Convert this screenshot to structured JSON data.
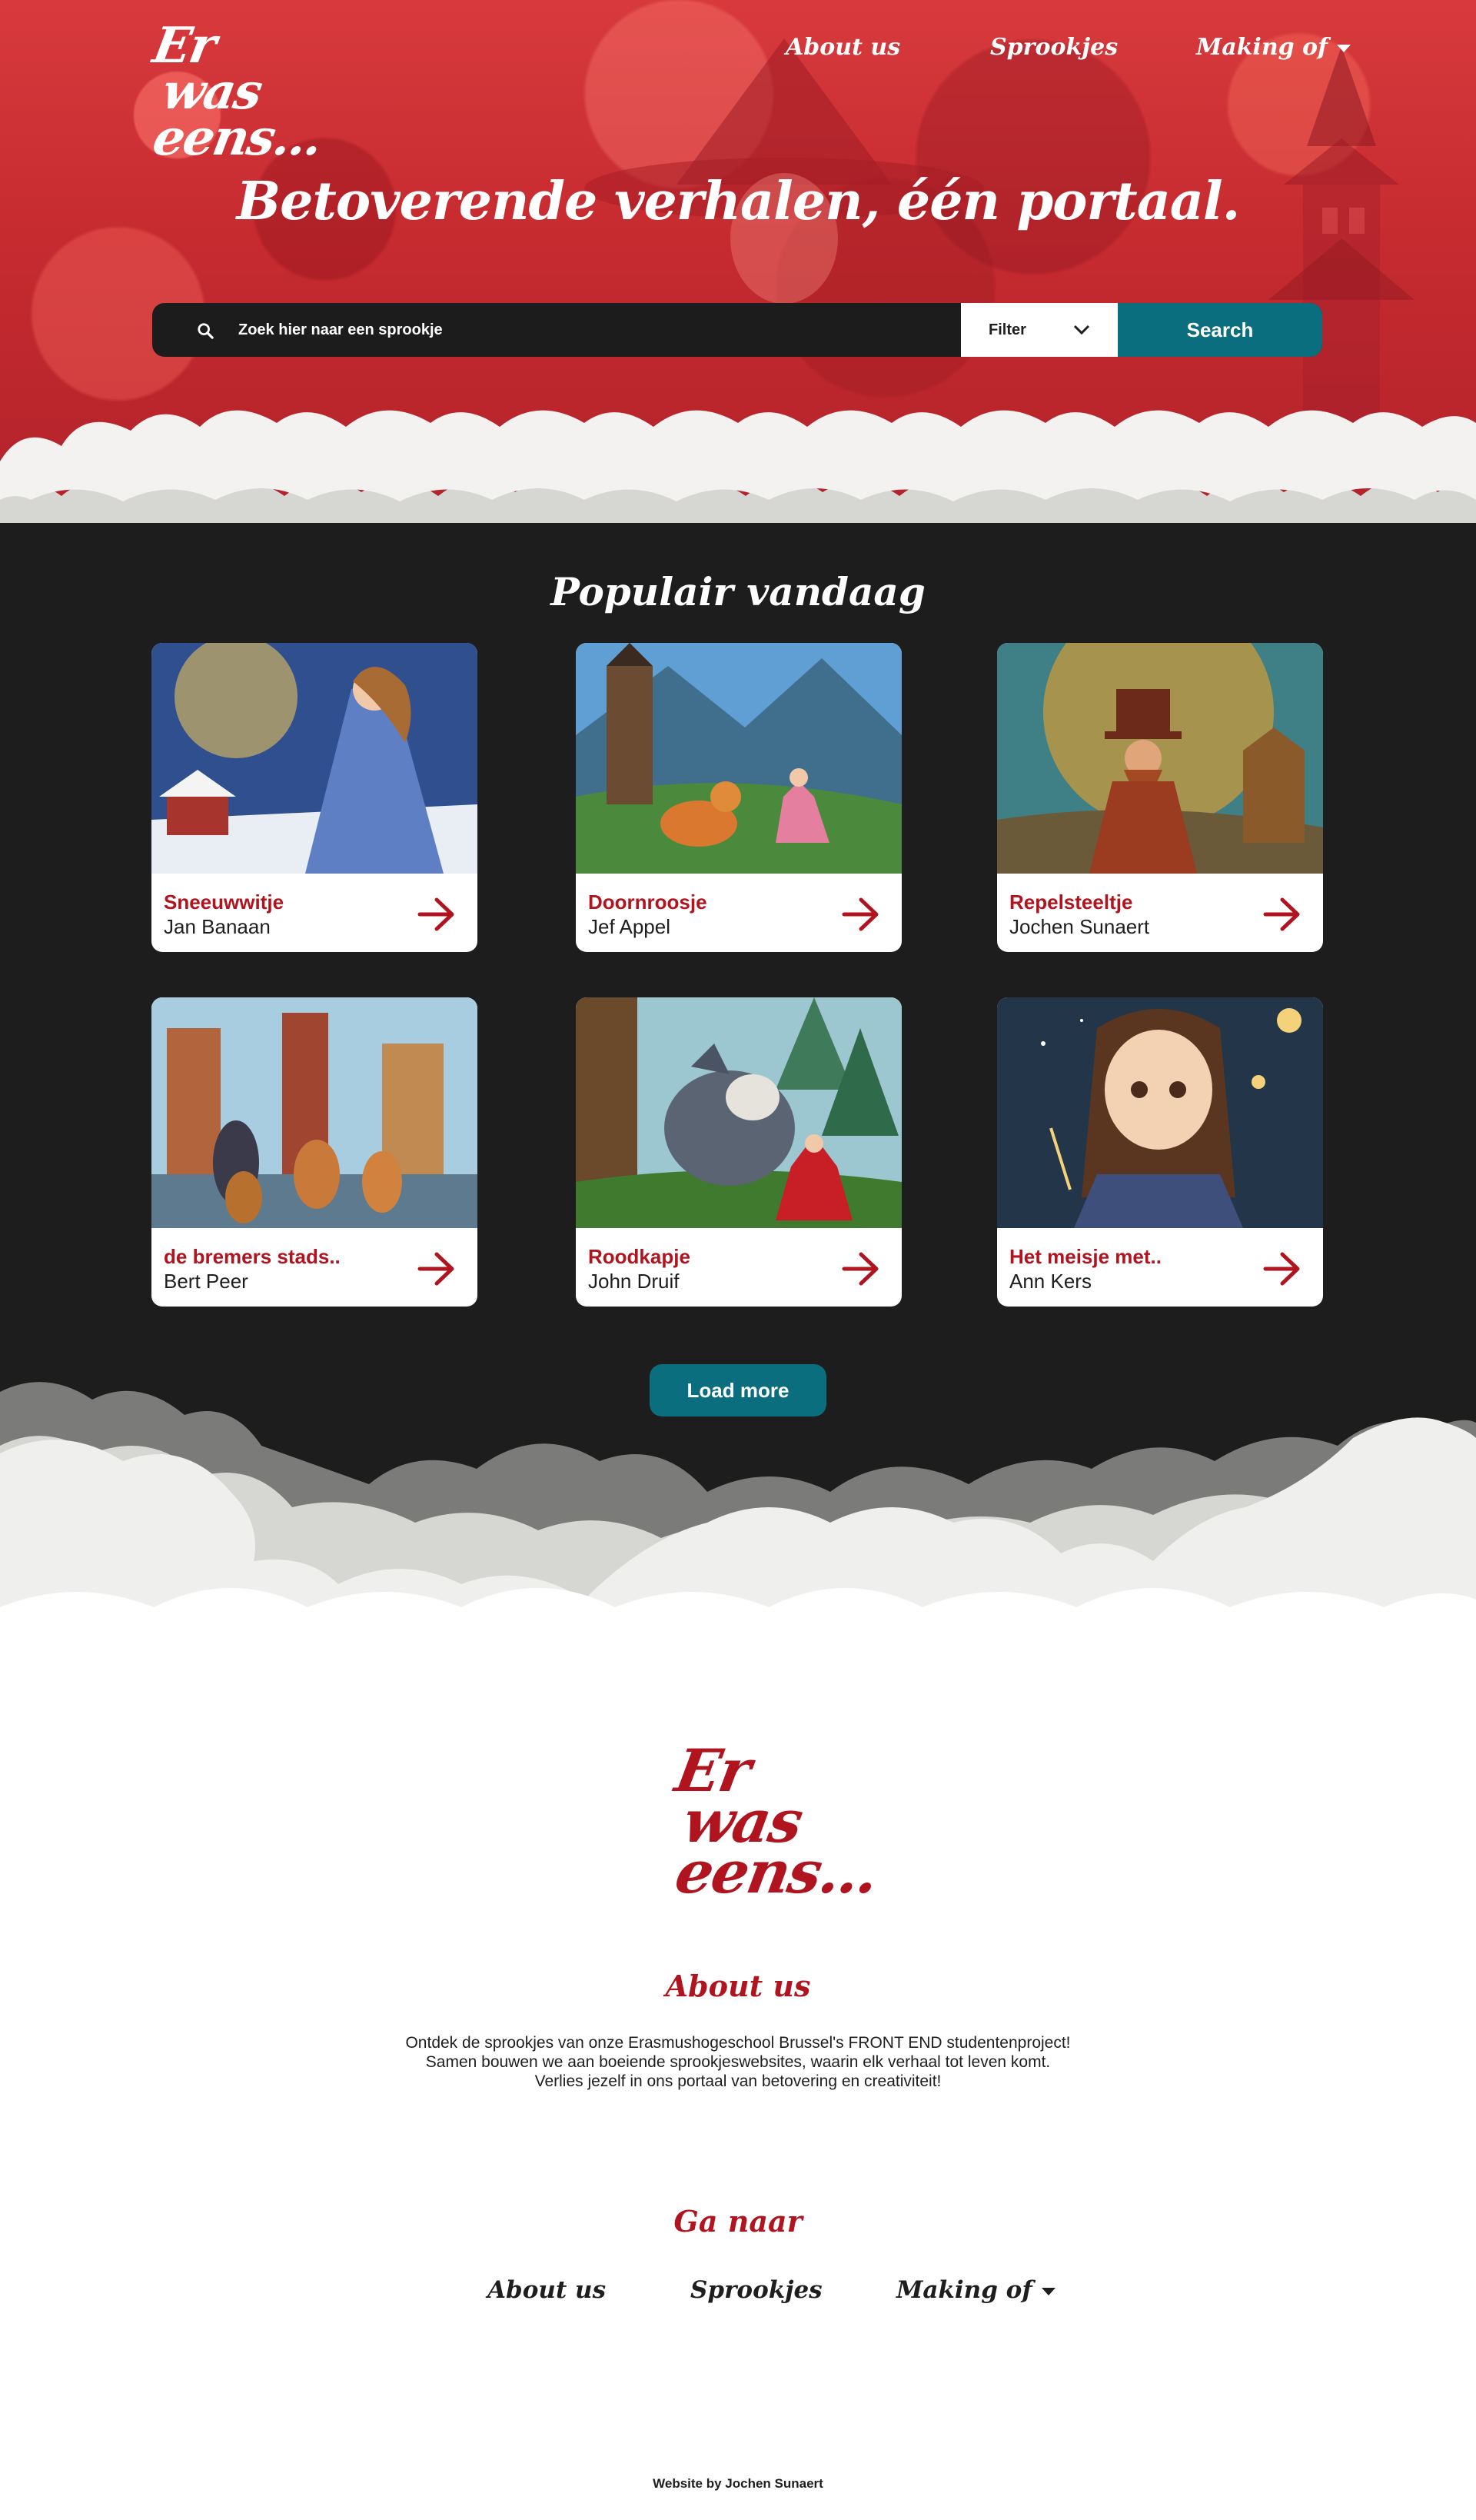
{
  "brand": {
    "logo_lines": [
      "Er",
      "was",
      "eens..."
    ],
    "accent": "#b0141f",
    "teal": "#0b6e7f"
  },
  "nav": {
    "about": "About us",
    "sprookjes": "Sprookjes",
    "making_of": "Making of"
  },
  "hero": {
    "tagline": "Betoverende verhalen, één portaal."
  },
  "search": {
    "placeholder": "Zoek hier naar een sprookje",
    "filter_label": "Filter",
    "button_label": "Search"
  },
  "popular": {
    "title": "Populair vandaag",
    "cards": [
      {
        "title": "Sneeuwwitje",
        "author": "Jan Banaan"
      },
      {
        "title": "Doornroosje",
        "author": "Jef Appel"
      },
      {
        "title": "Repelsteeltje",
        "author": "Jochen Sunaert"
      },
      {
        "title": "de bremers stads..",
        "author": "Bert Peer"
      },
      {
        "title": "Roodkapje",
        "author": "John Druif"
      },
      {
        "title": "Het meisje met..",
        "author": "Ann Kers"
      }
    ],
    "load_more": "Load more"
  },
  "footer": {
    "logo_lines": [
      "Er",
      "was",
      "eens..."
    ],
    "about_heading": "About us",
    "about_lines": [
      "Ontdek de sprookjes van onze Erasmushogeschool Brussel's FRONT END studentenproject!",
      "Samen bouwen we aan  boeiende sprookjeswebsites, waarin elk verhaal tot leven komt.",
      "Verlies jezelf in ons portaal van betovering en creativiteit!"
    ],
    "goto_heading": "Ga naar",
    "nav": {
      "about": "About us",
      "sprookjes": "Sprookjes",
      "making_of": "Making of"
    },
    "credit": "Website by Jochen Sunaert"
  }
}
